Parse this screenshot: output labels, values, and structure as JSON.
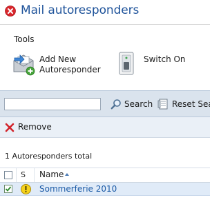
{
  "header": {
    "title": "Mail autoresponders",
    "close_icon": "close-icon",
    "title_color": "#20549b"
  },
  "tools": {
    "section_label": "Tools",
    "add": {
      "label": "Add New Autoresponder",
      "icon": "add-autoresponder-icon"
    },
    "switch": {
      "label": "Switch On",
      "icon": "switch-on-icon"
    }
  },
  "search": {
    "value": "",
    "placeholder": "",
    "search_label": "Search",
    "reset_label": "Reset Search"
  },
  "actions": {
    "remove_label": "Remove"
  },
  "list": {
    "total_text": "1 Autoresponders total",
    "columns": [
      "S",
      "Name"
    ],
    "sort_column": "Name",
    "rows": [
      {
        "selected": true,
        "status_icon": "warning-icon",
        "name": "Sommerferie 2010"
      }
    ]
  },
  "colors": {
    "toolbar_bg": "#dae3ed",
    "row_selected_bg": "#e0ebf8",
    "link": "#1b5aa6"
  }
}
